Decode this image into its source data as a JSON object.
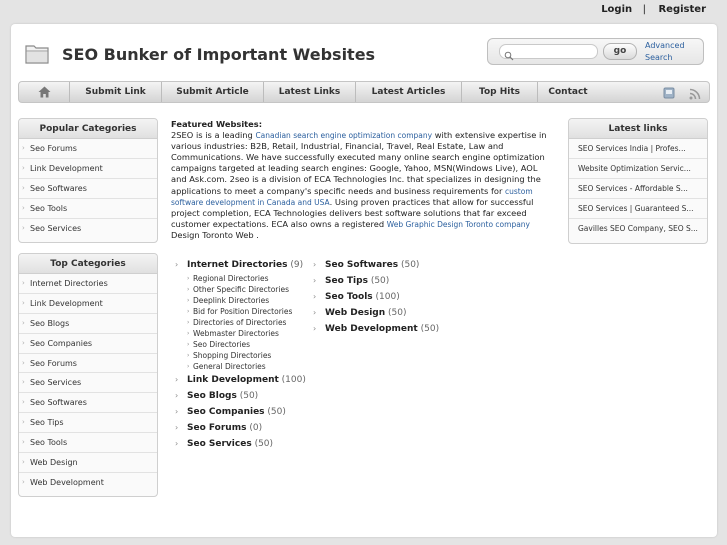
{
  "auth": {
    "login": "Login",
    "separator": "|",
    "register": "Register"
  },
  "header": {
    "title": "SEO Bunker of Important Websites"
  },
  "search": {
    "placeholder": "",
    "go_label": "go",
    "advanced_label": "Advanced Search"
  },
  "nav": {
    "items": [
      {
        "label": "Submit Link"
      },
      {
        "label": "Submit Article"
      },
      {
        "label": "Latest Links"
      },
      {
        "label": "Latest Articles"
      },
      {
        "label": "Top Hits"
      },
      {
        "label": "Contact"
      }
    ]
  },
  "popular": {
    "title": "Popular Categories",
    "items": [
      "Seo Forums",
      "Link Development",
      "Seo Softwares",
      "Seo Tools",
      "Seo Services"
    ]
  },
  "top": {
    "title": "Top Categories",
    "items": [
      "Internet Directories",
      "Link Development",
      "Seo Blogs",
      "Seo Companies",
      "Seo Forums",
      "Seo Services",
      "Seo Softwares",
      "Seo Tips",
      "Seo Tools",
      "Web Design",
      "Web Development"
    ]
  },
  "latest": {
    "title": "Latest links",
    "items": [
      "SEO Services India | Profes...",
      "Website Optimization Servic...",
      "SEO Services - Affordable S...",
      "SEO Services | Guaranteed S...",
      "Gavilles SEO Company, SEO S..."
    ]
  },
  "featured": {
    "title": "Featured Websites:",
    "p1": "2SEO is is a leading ",
    "link1": "Canadian search engine optimization company",
    "p2": " with extensive expertise in various industries: B2B, Retail, Industrial, Financial, Travel, Real Estate, Law and Communications. We have successfully executed many online search engine optimization campaigns targeted at leading search engines: Google, Yahoo, MSN(Windows Live), AOL and Ask.com. 2seo is a division of ECA Technologies Inc. that specializes in designing the applications to meet a company's specific needs and business requirements for ",
    "link2": "custom software development in Canada and USA",
    "p3": ". Using proven practices that allow for successful project completion, ECA Technologies delivers best software solutions that far exceed customer expectations. ECA also owns a registered ",
    "link3": "Web Graphic Design Toronto company",
    "p4": " Design Toronto Web ."
  },
  "directories": {
    "left": [
      {
        "name": "Internet Directories",
        "count": "(9)"
      },
      {
        "name": "Link Development",
        "count": "(100)"
      },
      {
        "name": "Seo Blogs",
        "count": "(50)"
      },
      {
        "name": "Seo Companies",
        "count": "(50)"
      },
      {
        "name": "Seo Forums",
        "count": "(0)"
      },
      {
        "name": "Seo Services",
        "count": "(50)"
      }
    ],
    "subdirs": [
      "Regional Directories",
      "Other Specific Directories",
      "Deeplink Directories",
      "Bid for Position Directories",
      "Directories of Directories",
      "Webmaster Directories",
      "Seo Directories",
      "Shopping Directories",
      "General Directories"
    ],
    "right": [
      {
        "name": "Seo Softwares",
        "count": "(50)"
      },
      {
        "name": "Seo Tips",
        "count": "(50)"
      },
      {
        "name": "Seo Tools",
        "count": "(100)"
      },
      {
        "name": "Web Design",
        "count": "(50)"
      },
      {
        "name": "Web Development",
        "count": "(50)"
      }
    ]
  },
  "icons": {
    "home": "home-icon",
    "folder": "folder-icon",
    "search": "search-icon",
    "bookmark": "bookmark-icon",
    "rss": "rss-icon"
  },
  "colors": {
    "link": "#2b5f9e",
    "background": "#e4e4e4"
  }
}
